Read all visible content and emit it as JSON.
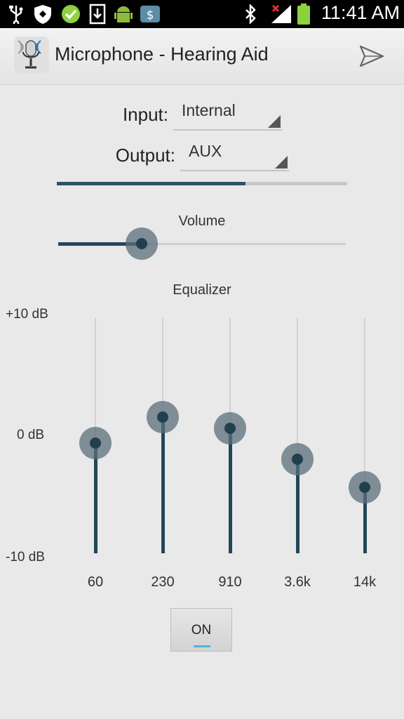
{
  "status_bar": {
    "time": "11:41 AM",
    "icons": [
      "usb-icon",
      "shield-icon",
      "check-icon",
      "download-icon",
      "android-icon",
      "sync-icon",
      "bluetooth-icon",
      "signal-icon",
      "battery-icon"
    ]
  },
  "action_bar": {
    "title": "Microphone - Hearing Aid",
    "app_icon": "microphone-icon",
    "share_icon": "send-icon"
  },
  "input": {
    "label": "Input:",
    "value": "Internal"
  },
  "output": {
    "label": "Output:",
    "value": "AUX"
  },
  "level_progress": 0.65,
  "volume": {
    "label": "Volume",
    "level": 0.29
  },
  "equalizer": {
    "label": "Equalizer",
    "db_labels": {
      "max": "+10 dB",
      "mid": "0 dB",
      "min": "-10 dB"
    },
    "bands": [
      {
        "freq": "60",
        "level_db": -0.6
      },
      {
        "freq": "230",
        "level_db": 1.6
      },
      {
        "freq": "910",
        "level_db": 0.6
      },
      {
        "freq": "3.6k",
        "level_db": -2.0
      },
      {
        "freq": "14k",
        "level_db": -4.4
      }
    ]
  },
  "toggle": {
    "label": "ON",
    "indicator_color": "#4fb6e0"
  },
  "colors": {
    "accent": "#234757",
    "thumb": "#5a6e7a"
  }
}
